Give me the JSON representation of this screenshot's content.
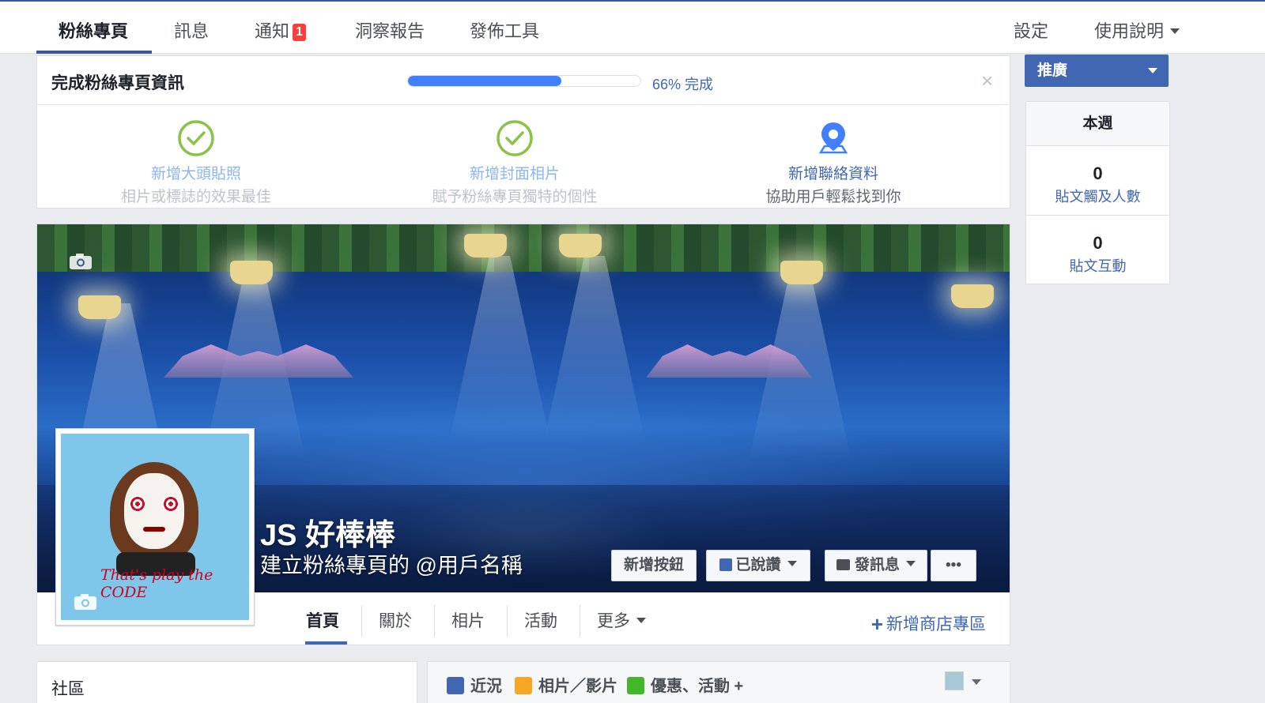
{
  "topnav": {
    "tabs": [
      {
        "label": "粉絲專頁"
      },
      {
        "label": "訊息"
      },
      {
        "label": "通知",
        "badge": "1"
      },
      {
        "label": "洞察報告"
      },
      {
        "label": "發佈工具"
      }
    ],
    "settings": "設定",
    "help": "使用說明"
  },
  "completion": {
    "title": "完成粉絲專頁資訊",
    "progress_percent": 66,
    "progress_text": "66% 完成",
    "close": "×",
    "steps": [
      {
        "title": "新增大頭貼照",
        "desc": "相片或標誌的效果最佳",
        "icon": "check-circle-icon"
      },
      {
        "title": "新增封面相片",
        "desc": "賦予粉絲專頁獨特的個性",
        "icon": "check-circle-icon"
      },
      {
        "title": "新增聯絡資料",
        "desc": "協助用戶輕鬆找到你",
        "icon": "map-pin-icon"
      }
    ]
  },
  "cover": {
    "page_name": "JS 好棒棒",
    "username_prompt": "建立粉絲專頁的 @用戶名稱",
    "buttons": {
      "add_button": "新增按鈕",
      "liked": "已說讚",
      "message": "發訊息",
      "more": "•••"
    },
    "avatar_tagline": "That's play the CODE"
  },
  "page_tabs": {
    "items": [
      "首頁",
      "關於",
      "相片",
      "活動",
      "更多"
    ],
    "add_shop": "新增商店專區",
    "add_shop_plus": "+"
  },
  "sidebar": {
    "promote": "推廣",
    "week_title": "本週",
    "stats": [
      {
        "value": "0",
        "label": "貼文觸及人數"
      },
      {
        "value": "0",
        "label": "貼文互動"
      }
    ]
  },
  "bottom": {
    "community": "社區",
    "composer": {
      "status": "近況",
      "photo_video": "相片／影片",
      "offer_event": "優惠、活動 +"
    }
  },
  "colors": {
    "brand": "#4267b2",
    "progress": "#4080ff",
    "badge": "#fa3e3e",
    "done_check": "#8bc34a"
  }
}
